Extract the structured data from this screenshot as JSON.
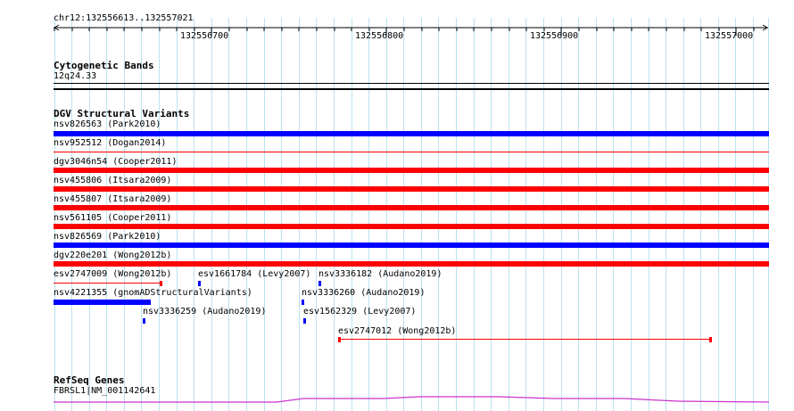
{
  "ruler": {
    "region": "chr12:132556613..132557021",
    "ticks": [
      "132556700",
      "132556800",
      "132556900",
      "132557000"
    ]
  },
  "cytoband": {
    "title": "Cytogenetic Bands",
    "band": "12q24.33"
  },
  "dgv": {
    "title": "DGV Structural Variants",
    "rows": [
      {
        "label": "nsv826563 (Park2010)",
        "color": "#0000ff"
      },
      {
        "label": "nsv952512 (Dogan2014)",
        "color": "#ff0000"
      },
      {
        "label": "dgv3046n54 (Cooper2011)",
        "color": "#ff0000"
      },
      {
        "label": "nsv455806 (Itsara2009)",
        "color": "#ff0000"
      },
      {
        "label": "nsv455807 (Itsara2009)",
        "color": "#ff0000"
      },
      {
        "label": "nsv561105 (Cooper2011)",
        "color": "#ff0000"
      },
      {
        "label": "nsv826569 (Park2010)",
        "color": "#0000ff"
      },
      {
        "label": "dgv220e201 (Wong2012b)",
        "color": "#ff0000"
      }
    ],
    "small": [
      {
        "label": "esv2747009 (Wong2012b)",
        "color": "#ff0000"
      },
      {
        "label": "esv1661784 (Levy2007)",
        "color": "#0000ff"
      },
      {
        "label": "nsv3336182 (Audano2019)",
        "color": "#0000ff"
      },
      {
        "label": "nsv4221355 (gnomADStructuralVariants)",
        "color": "#0000ff"
      },
      {
        "label": "nsv3336260 (Audano2019)",
        "color": "#0000ff"
      },
      {
        "label": "nsv3336259 (Audano2019)",
        "color": "#0000ff"
      },
      {
        "label": "esv1562329 (Levy2007)",
        "color": "#0000ff"
      },
      {
        "label": "esv2747012 (Wong2012b)",
        "color": "#ff0000"
      }
    ]
  },
  "refseq": {
    "title": "RefSeq Genes",
    "gene": "FBRSL1|NM_001142641",
    "color": "#cc33cc"
  }
}
